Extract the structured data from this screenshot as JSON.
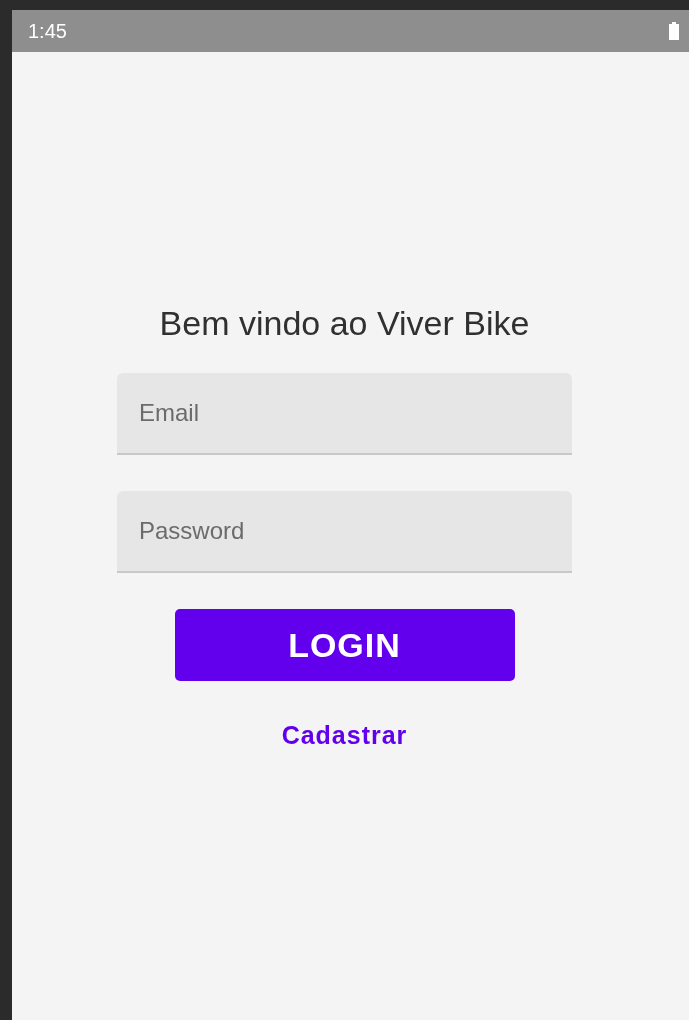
{
  "status_bar": {
    "time": "1:45"
  },
  "title": "Bem vindo ao Viver Bike",
  "fields": [
    {
      "placeholder": "Email"
    },
    {
      "placeholder": "Password"
    }
  ],
  "login_button": "LOGIN",
  "register_link": "Cadastrar"
}
